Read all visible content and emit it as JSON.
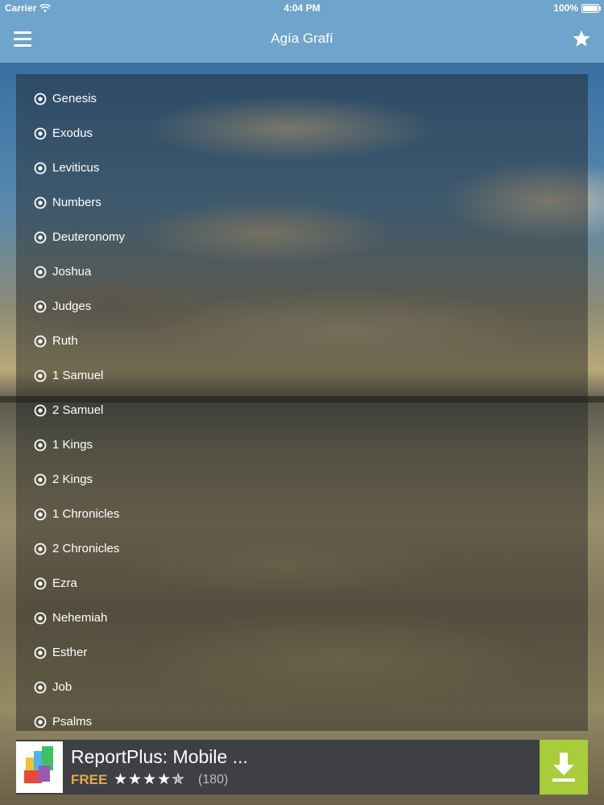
{
  "status_bar": {
    "carrier": "Carrier",
    "time": "4:04 PM",
    "battery": "100%"
  },
  "nav": {
    "title": "Agía Grafí",
    "menu_icon": "hamburger-menu-icon",
    "favorite_icon": "star-icon"
  },
  "books": [
    {
      "label": "Genesis"
    },
    {
      "label": "Exodus"
    },
    {
      "label": "Leviticus"
    },
    {
      "label": "Numbers"
    },
    {
      "label": "Deuteronomy"
    },
    {
      "label": "Joshua"
    },
    {
      "label": "Judges"
    },
    {
      "label": "Ruth"
    },
    {
      "label": "1 Samuel"
    },
    {
      "label": "2 Samuel"
    },
    {
      "label": "1 Kings"
    },
    {
      "label": "2 Kings"
    },
    {
      "label": "1 Chronicles"
    },
    {
      "label": "2 Chronicles"
    },
    {
      "label": "Ezra"
    },
    {
      "label": "Nehemiah"
    },
    {
      "label": "Esther"
    },
    {
      "label": "Job"
    },
    {
      "label": "Psalms"
    }
  ],
  "ad": {
    "app_title": "ReportPlus: Mobile ...",
    "price": "FREE",
    "stars": "★★★★✯",
    "rating": 4.5,
    "reviews": "(180)",
    "download_icon": "download-icon"
  },
  "colors": {
    "nav_bar": "#6fa4cc",
    "ad_background": "#3e4043",
    "ad_price": "#e6a84a",
    "download_button": "#a8cc3a"
  }
}
